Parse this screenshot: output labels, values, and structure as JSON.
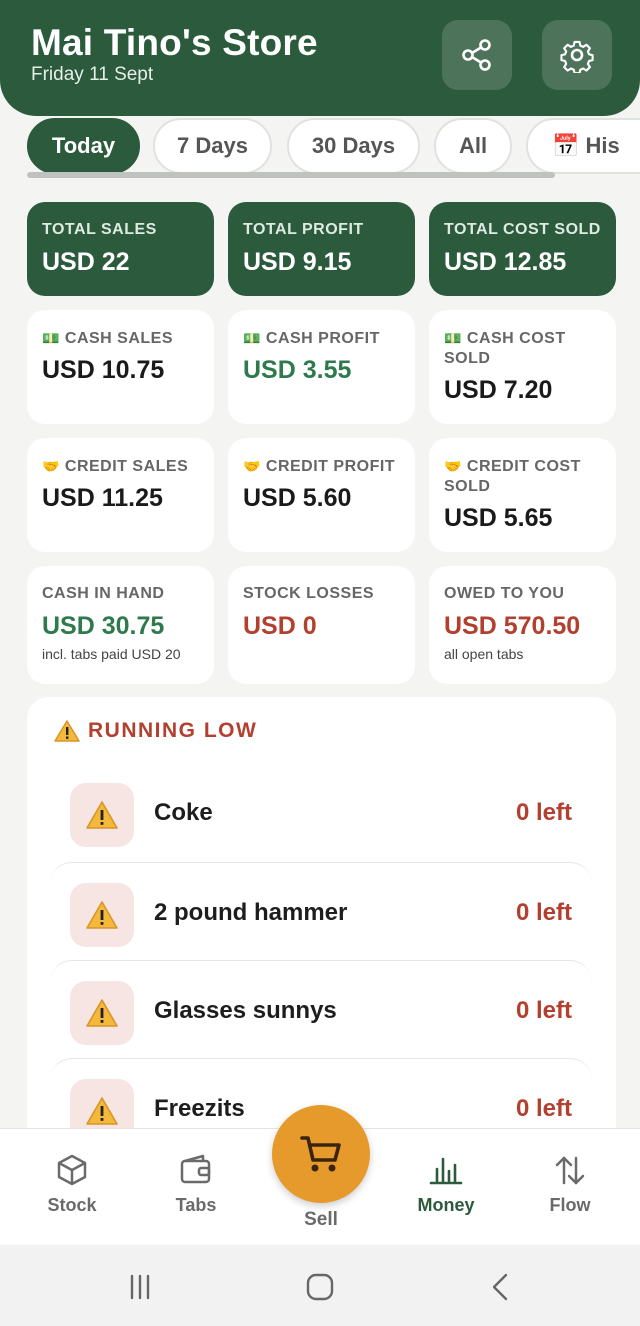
{
  "header": {
    "title": "Mai Tino's Store",
    "date": "Friday 11 Sept",
    "share_icon": "share-icon",
    "settings_icon": "gear-icon"
  },
  "tabs": [
    {
      "label": "Today",
      "active": true
    },
    {
      "label": "7 Days",
      "active": false
    },
    {
      "label": "30 Days",
      "active": false
    },
    {
      "label": "All",
      "active": false
    },
    {
      "label": "📅 His",
      "active": false
    }
  ],
  "summary": {
    "total_sales": {
      "label": "TOTAL SALES",
      "value": "USD 22"
    },
    "total_profit": {
      "label": "TOTAL PROFIT",
      "value": "USD 9.15"
    },
    "total_cost_sold": {
      "label": "TOTAL COST SOLD",
      "value": "USD 12.85"
    }
  },
  "cash": {
    "emoji": "💵",
    "sales": {
      "label": "CASH SALES",
      "value": "USD 10.75"
    },
    "profit": {
      "label": "CASH PROFIT",
      "value": "USD 3.55"
    },
    "cost_sold": {
      "label": "CASH COST SOLD",
      "value": "USD 7.20"
    }
  },
  "credit": {
    "emoji": "🤝",
    "sales": {
      "label": "CREDIT SALES",
      "value": "USD 11.25"
    },
    "profit": {
      "label": "CREDIT PROFIT",
      "value": "USD 5.60"
    },
    "cost_sold": {
      "label": "CREDIT COST SOLD",
      "value": "USD 5.65"
    }
  },
  "other": {
    "cash_in_hand": {
      "label": "CASH IN HAND",
      "value": "USD 30.75",
      "sub": "incl. tabs paid USD 20"
    },
    "stock_losses": {
      "label": "STOCK LOSSES",
      "value": "USD 0"
    },
    "owed_to_you": {
      "label": "OWED TO YOU",
      "value": "USD 570.50",
      "sub": "all open tabs"
    }
  },
  "running_low": {
    "title": "RUNNING LOW",
    "items": [
      {
        "name": "Coke",
        "qty": "0 left"
      },
      {
        "name": "2 pound hammer",
        "qty": "0 left"
      },
      {
        "name": "Glasses sunnys",
        "qty": "0 left"
      },
      {
        "name": "Freezits",
        "qty": "0 left"
      }
    ]
  },
  "bottom_nav": {
    "stock": "Stock",
    "tabs": "Tabs",
    "sell": "Sell",
    "money": "Money",
    "flow": "Flow",
    "active": "Money"
  },
  "colors": {
    "brand_green": "#2b5a3c",
    "accent_orange": "#e79a2c",
    "alert_red": "#b3402f",
    "profit_green": "#2f7a4c"
  }
}
